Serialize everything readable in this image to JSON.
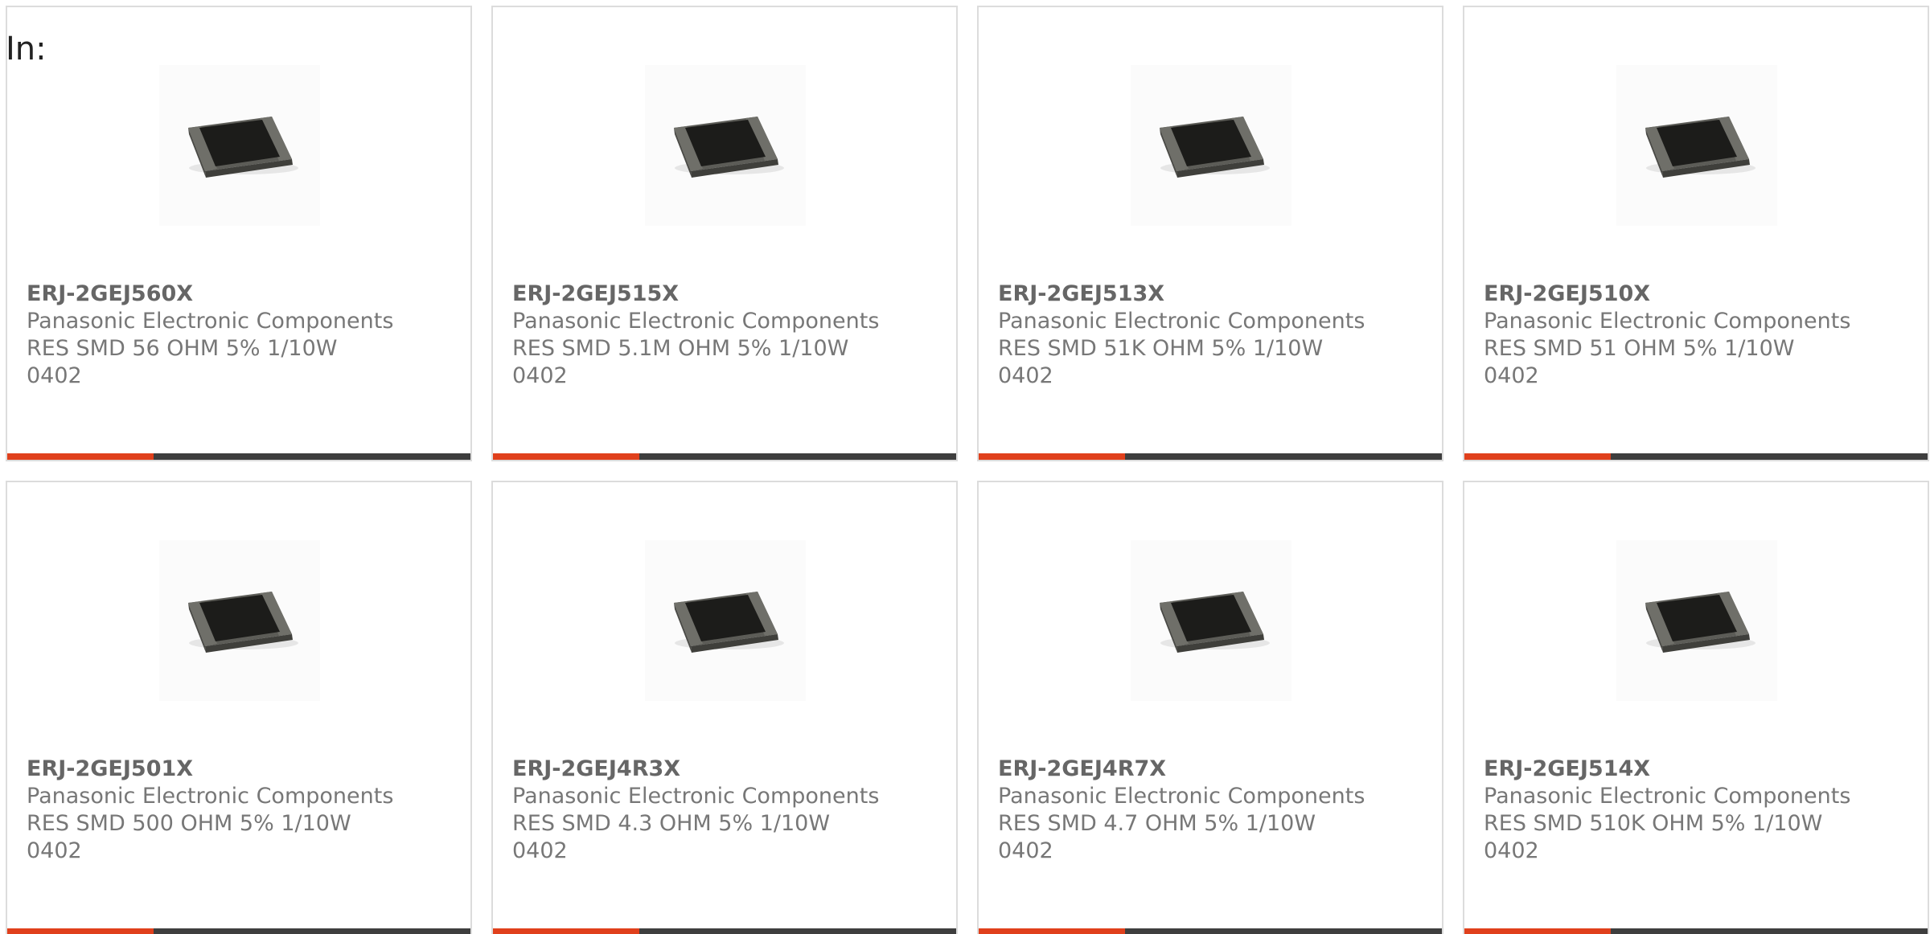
{
  "heading": "In:",
  "products": [
    {
      "part": "ERJ-2GEJ560X",
      "manufacturer": "Panasonic Electronic Components",
      "description": "RES SMD 56 OHM 5% 1/10W 0402",
      "image_icon": "smd-resistor-icon"
    },
    {
      "part": "ERJ-2GEJ515X",
      "manufacturer": "Panasonic Electronic Components",
      "description": "RES SMD 5.1M OHM 5% 1/10W 0402",
      "image_icon": "smd-resistor-icon"
    },
    {
      "part": "ERJ-2GEJ513X",
      "manufacturer": "Panasonic Electronic Components",
      "description": "RES SMD 51K OHM 5% 1/10W 0402",
      "image_icon": "smd-resistor-icon"
    },
    {
      "part": "ERJ-2GEJ510X",
      "manufacturer": "Panasonic Electronic Components",
      "description": "RES SMD 51 OHM 5% 1/10W 0402",
      "image_icon": "smd-resistor-icon"
    },
    {
      "part": "ERJ-2GEJ501X",
      "manufacturer": "Panasonic Electronic Components",
      "description": "RES SMD 500 OHM 5% 1/10W 0402",
      "image_icon": "smd-resistor-icon"
    },
    {
      "part": "ERJ-2GEJ4R3X",
      "manufacturer": "Panasonic Electronic Components",
      "description": "RES SMD 4.3 OHM 5% 1/10W 0402",
      "image_icon": "smd-resistor-icon"
    },
    {
      "part": "ERJ-2GEJ4R7X",
      "manufacturer": "Panasonic Electronic Components",
      "description": "RES SMD 4.7 OHM 5% 1/10W 0402",
      "image_icon": "smd-resistor-icon"
    },
    {
      "part": "ERJ-2GEJ514X",
      "manufacturer": "Panasonic Electronic Components",
      "description": "RES SMD 510K OHM 5% 1/10W 0402",
      "image_icon": "smd-resistor-icon"
    }
  ],
  "colors": {
    "accent": "#e0401c",
    "bar": "#3e3e3e",
    "card_border": "#dcdcdc",
    "text": "#777777"
  }
}
